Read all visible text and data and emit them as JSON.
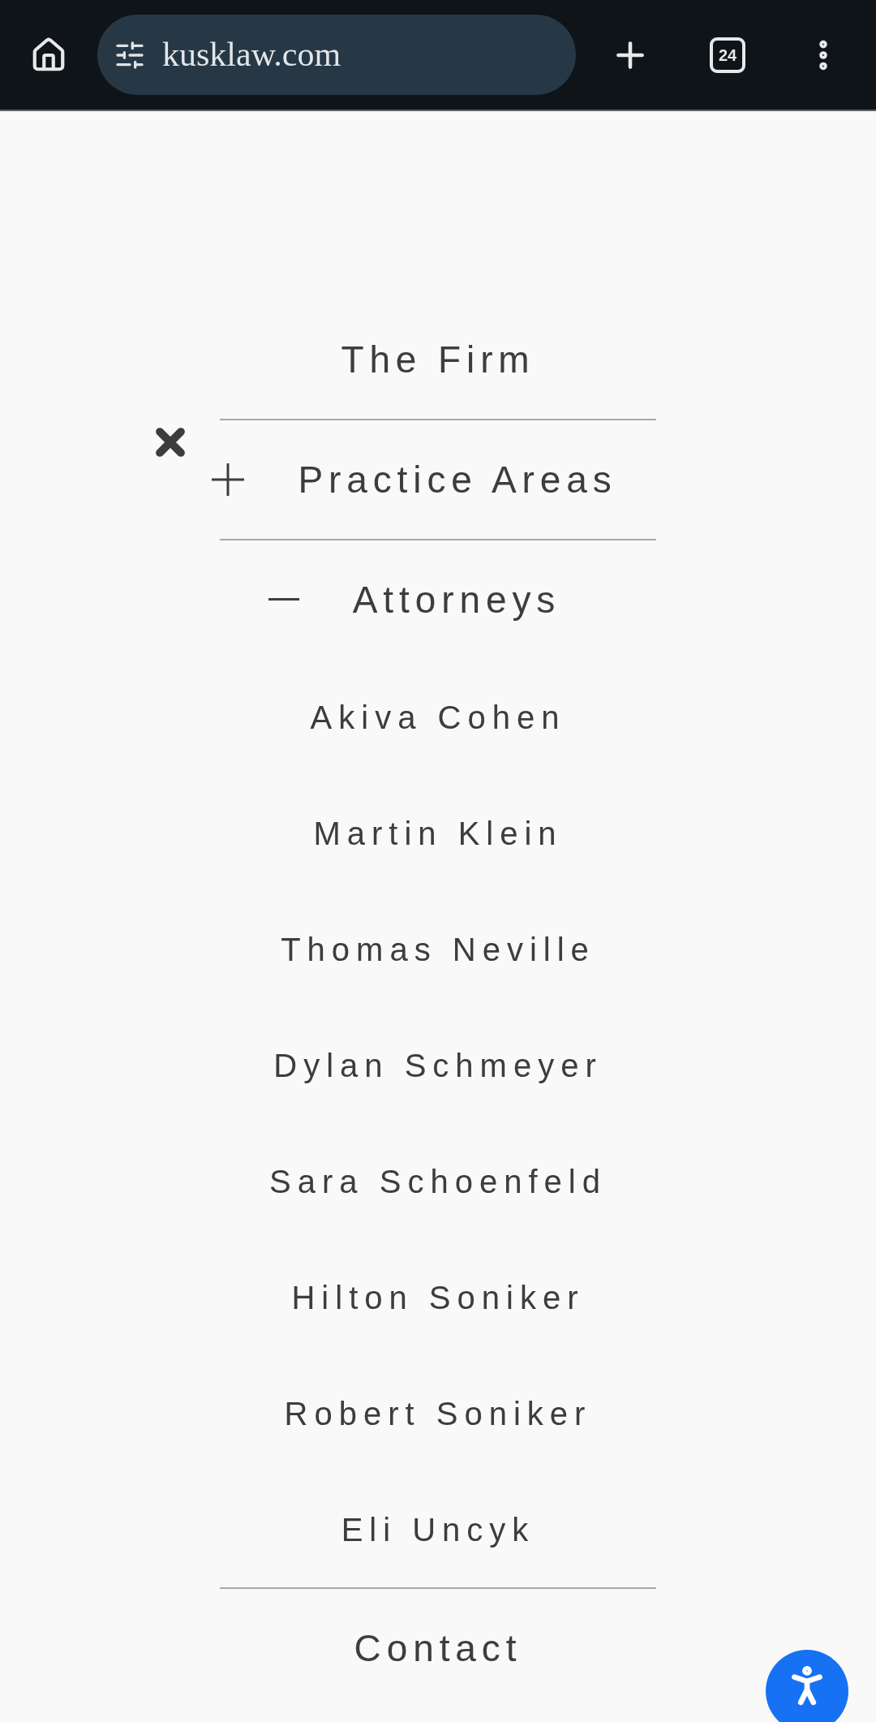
{
  "browser": {
    "url": "kusklaw.com",
    "tab_count": "24"
  },
  "menu": [
    {
      "label": "The Firm",
      "kind": "link"
    },
    {
      "label": "Practice Areas",
      "kind": "expandable",
      "expanded": false
    },
    {
      "label": "Attorneys",
      "kind": "expandable",
      "expanded": true,
      "children": [
        {
          "label": "Akiva Cohen"
        },
        {
          "label": "Martin Klein"
        },
        {
          "label": "Thomas Neville"
        },
        {
          "label": "Dylan Schmeyer"
        },
        {
          "label": "Sara Schoenfeld"
        },
        {
          "label": "Hilton Soniker"
        },
        {
          "label": "Robert Soniker"
        },
        {
          "label": "Eli Uncyk"
        }
      ]
    },
    {
      "label": "Contact",
      "kind": "link"
    }
  ]
}
